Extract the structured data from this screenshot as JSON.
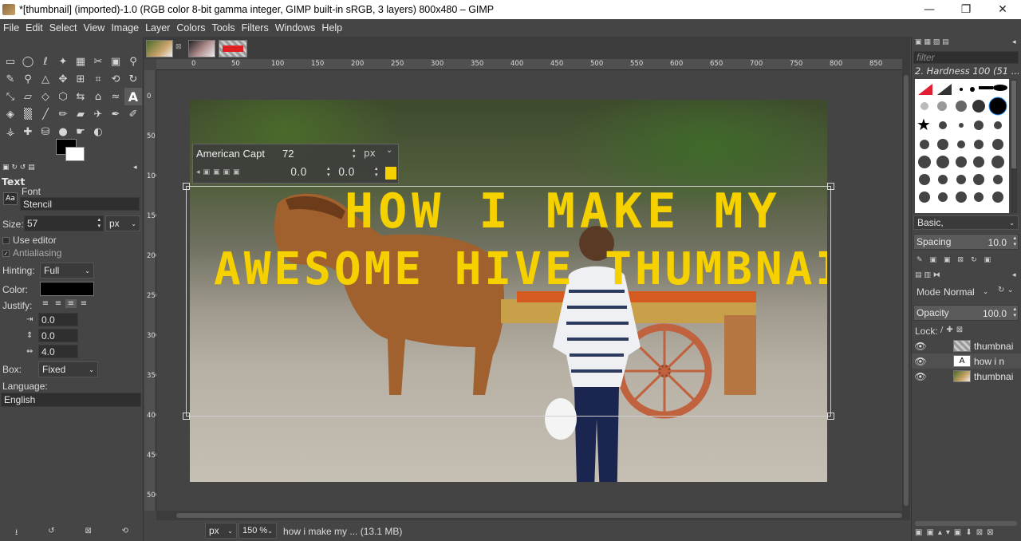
{
  "window": {
    "title": "*[thumbnail] (imported)-1.0 (RGB color 8-bit gamma integer, GIMP built-in sRGB, 3 layers) 800x480 – GIMP",
    "minimize": "—",
    "maximize": "❐",
    "close": "✕"
  },
  "menu": [
    "File",
    "Edit",
    "Select",
    "View",
    "Image",
    "Layer",
    "Colors",
    "Tools",
    "Filters",
    "Windows",
    "Help"
  ],
  "tool_options": {
    "title": "Text",
    "font_label": "Font",
    "font_value": "Stencil",
    "size_label": "Size:",
    "size_value": "57",
    "size_unit": "px",
    "use_editor": "Use editor",
    "antialiasing": "Antialiasing",
    "hinting_label": "Hinting:",
    "hinting_value": "Full",
    "color_label": "Color:",
    "color_value": "#000000",
    "justify_label": "Justify:",
    "indent_value": "0.0",
    "line_spacing_value": "0.0",
    "letter_spacing_value": "4.0",
    "box_label": "Box:",
    "box_value": "Fixed",
    "language_label": "Language:",
    "language_value": "English"
  },
  "colors": {
    "foreground": "#000000",
    "background": "#ffffff",
    "text_fill": "#f5d100"
  },
  "rulers": {
    "top": [
      "0",
      "50",
      "100",
      "150",
      "200",
      "250",
      "300",
      "350",
      "400",
      "450",
      "500",
      "550",
      "600",
      "650",
      "700",
      "750",
      "800",
      "850"
    ],
    "left": [
      "0",
      "50",
      "100",
      "150",
      "200",
      "250",
      "300",
      "350",
      "400",
      "450",
      "500"
    ]
  },
  "canvas_text": {
    "line1": "HOW I MAKE MY",
    "line2": "AWESOME HIVE THUMBNAILS"
  },
  "text_toolbar": {
    "font": "American Capt",
    "size": "72",
    "unit": "px",
    "baseline": "0.0",
    "kerning": "0.0",
    "color": "#f5d100"
  },
  "dock": {
    "filter_placeholder": "filter",
    "brush_name": "2. Hardness 100 (51 ...",
    "preset": "Basic,",
    "spacing_label": "Spacing",
    "spacing_value": "10.0",
    "mode_label": "Mode",
    "mode_value": "Normal",
    "opacity_label": "Opacity",
    "opacity_value": "100.0",
    "lock_label": "Lock:",
    "layers": [
      {
        "name": "thumbnai"
      },
      {
        "name": "how  i  n"
      },
      {
        "name": "thumbnai"
      }
    ]
  },
  "status": {
    "unit": "px",
    "zoom": "150 %",
    "info": "how  i  make  my ... (13.1 MB)"
  }
}
